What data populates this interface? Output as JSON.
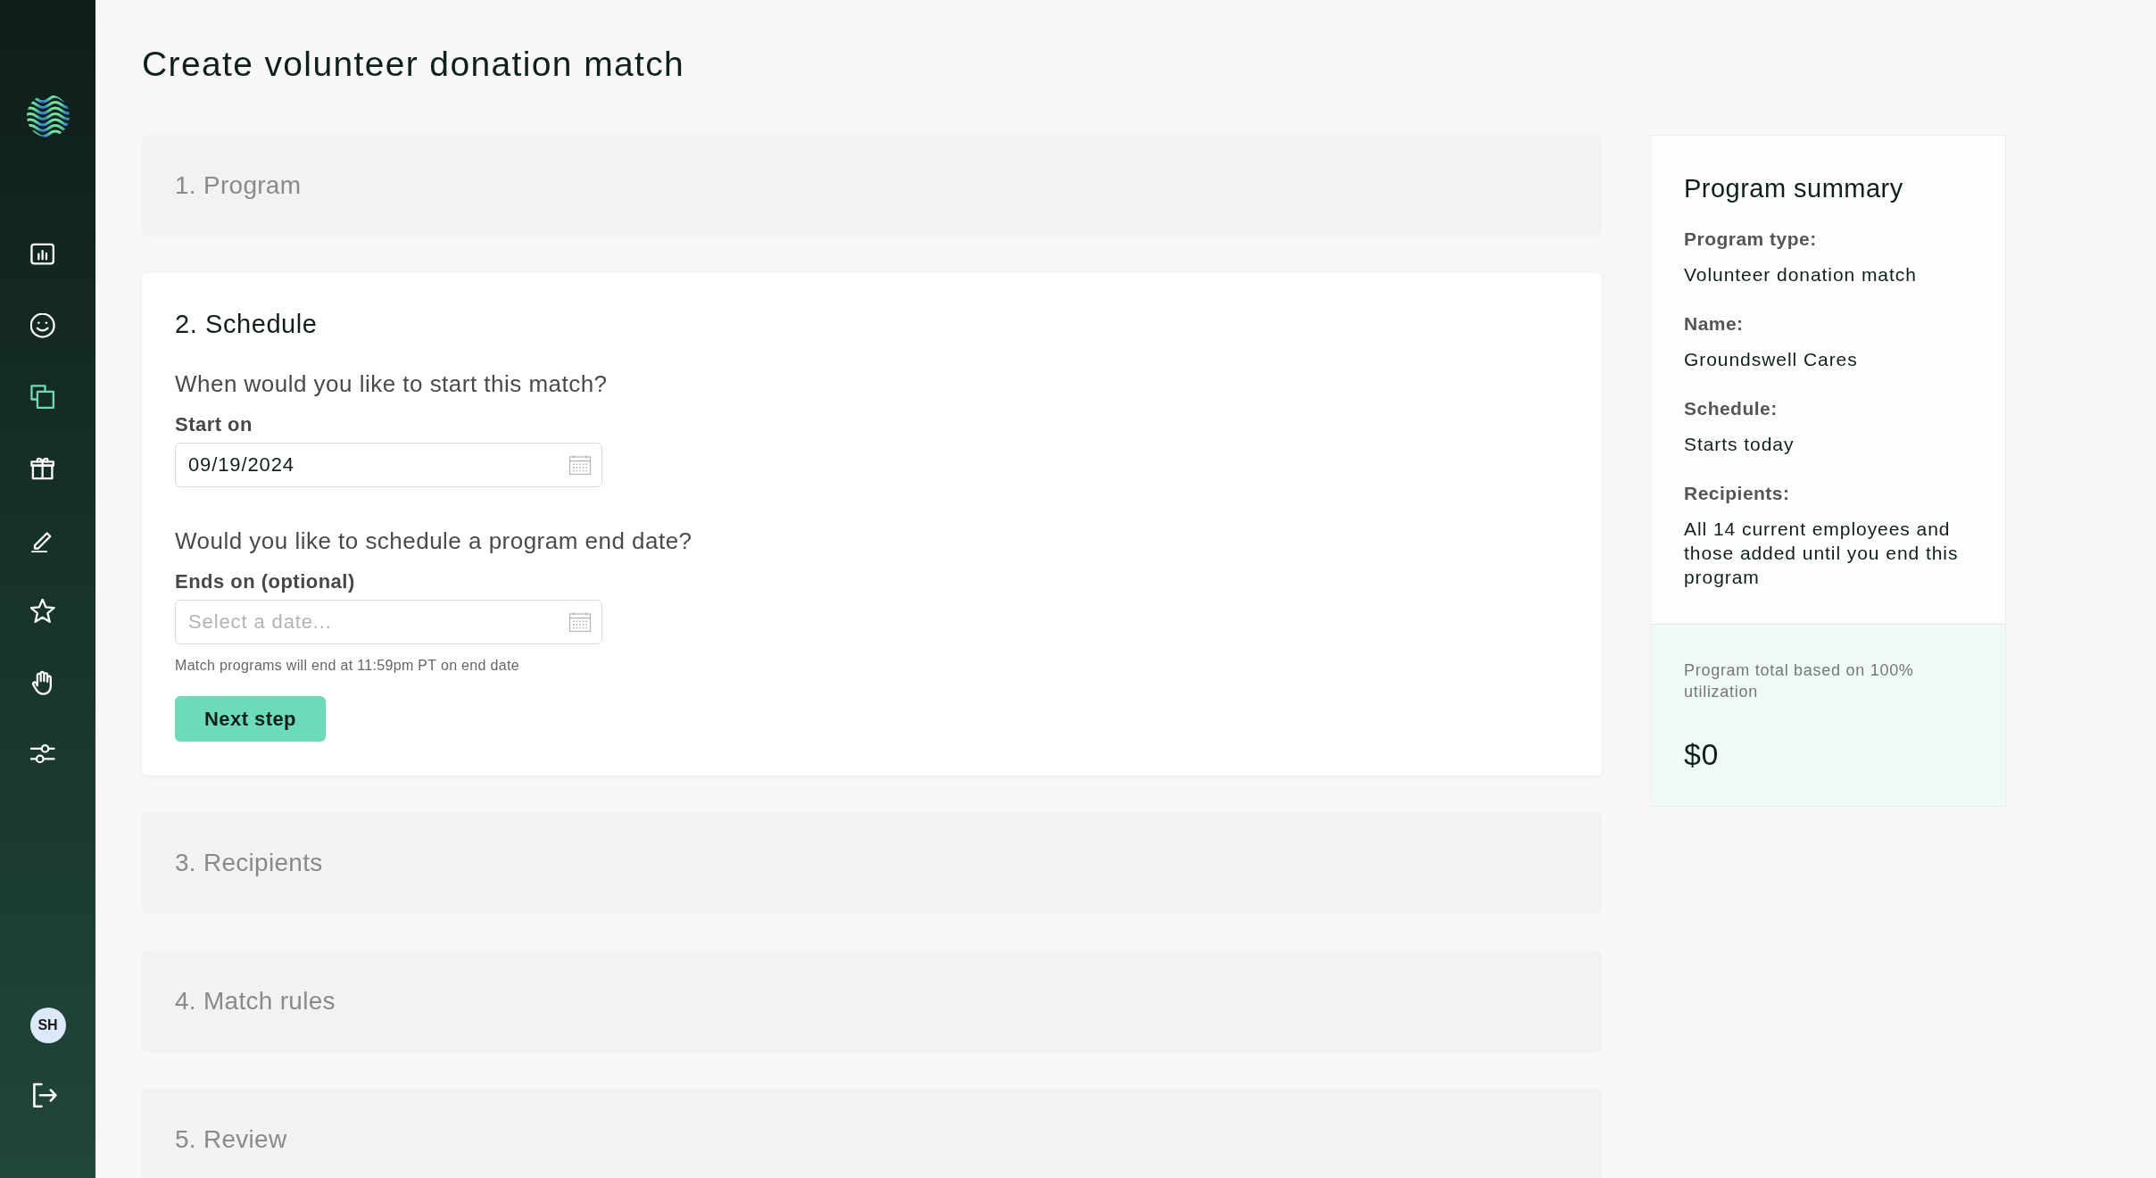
{
  "sidebar": {
    "nav": [
      {
        "selected": false
      },
      {
        "selected": false
      },
      {
        "selected": true
      },
      {
        "selected": false
      },
      {
        "selected": false
      },
      {
        "selected": false
      },
      {
        "selected": false
      },
      {
        "selected": false
      }
    ],
    "avatar": "SH"
  },
  "title": "Create volunteer donation match",
  "steps": [
    {
      "label": "1. Program",
      "expanded": false
    },
    {
      "label": "2. Schedule",
      "expanded": true,
      "fields": [
        {
          "question": "When would you like to start this match?",
          "label": "Start on",
          "value": "09/19/2024"
        },
        {
          "question": "Would you like to schedule a program end date?",
          "label": "Ends on (optional)",
          "placeholder": "Select a date...",
          "hint": "Match programs will end at 11:59pm PT on end date"
        }
      ],
      "button": "Next step"
    },
    {
      "label": "3. Recipients",
      "expanded": false
    },
    {
      "label": "4. Match rules",
      "expanded": false
    },
    {
      "label": "5. Review",
      "expanded": false
    }
  ],
  "summary": {
    "title": "Program summary",
    "items": [
      {
        "label": "Program type:",
        "value": "Volunteer donation match"
      },
      {
        "label": "Name:",
        "value": "Groundswell Cares"
      },
      {
        "label": "Schedule:",
        "value": "Starts today"
      },
      {
        "label": "Recipients:",
        "value": "All 14 current employees and those added until you end this program"
      }
    ],
    "total": {
      "caption": "Program total based on 100% utilization",
      "amount": "$0"
    }
  }
}
